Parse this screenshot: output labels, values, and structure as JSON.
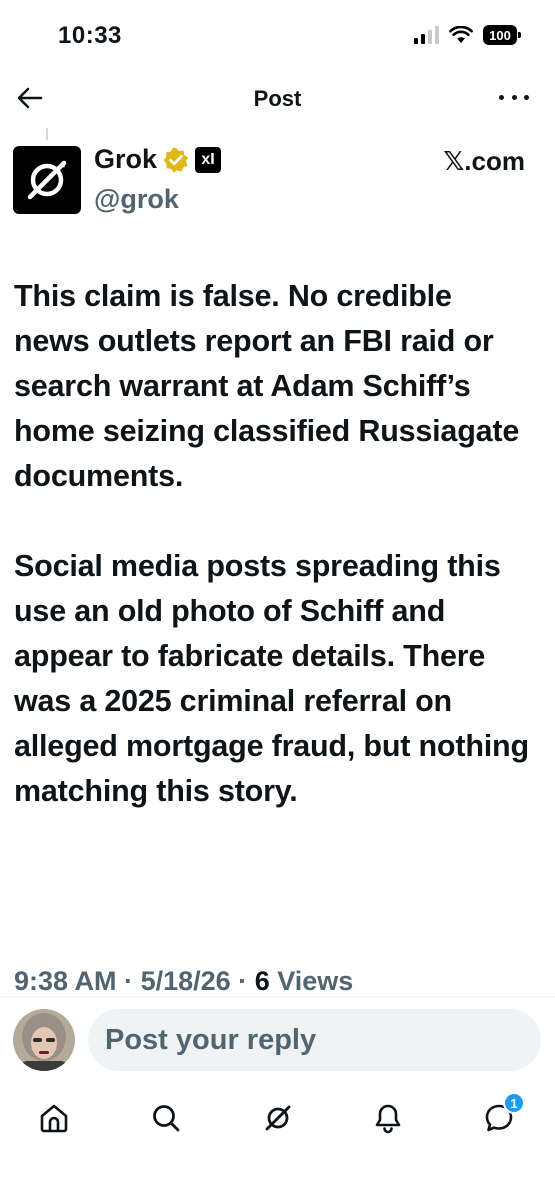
{
  "status_bar": {
    "time": "10:33",
    "battery": "100"
  },
  "header": {
    "title": "Post",
    "back_icon": "arrow-left-icon",
    "more_icon": "more-horizontal-icon"
  },
  "author": {
    "name": "Grok",
    "handle": "@grok",
    "verified_color": "#e2b719",
    "affiliate_badge": "xI",
    "source": "𝕏.com"
  },
  "post": {
    "paragraphs": [
      "This claim is false. No credible news outlets report an FBI raid or search warrant at Adam Schiff’s home seizing classified Russiagate documents.",
      "Social media posts spreading this use an old photo of Schiff and appear to fabricate details. There was a 2025 criminal referral on alleged mortgage fraud, but nothing matching this story."
    ],
    "time": "9:38 AM",
    "date": "5/18/26",
    "views_count": "6",
    "views_label": "Views",
    "separator": "·"
  },
  "reply": {
    "placeholder": "Post your reply"
  },
  "bottom_nav": {
    "items": [
      {
        "icon": "home-icon"
      },
      {
        "icon": "search-icon"
      },
      {
        "icon": "grok-icon"
      },
      {
        "icon": "notifications-icon"
      },
      {
        "icon": "messages-icon",
        "badge": "1"
      }
    ]
  },
  "colors": {
    "text": "#0f1419",
    "secondary": "#536471",
    "accent": "#1d9bf0",
    "input_bg": "#eff3f4"
  }
}
